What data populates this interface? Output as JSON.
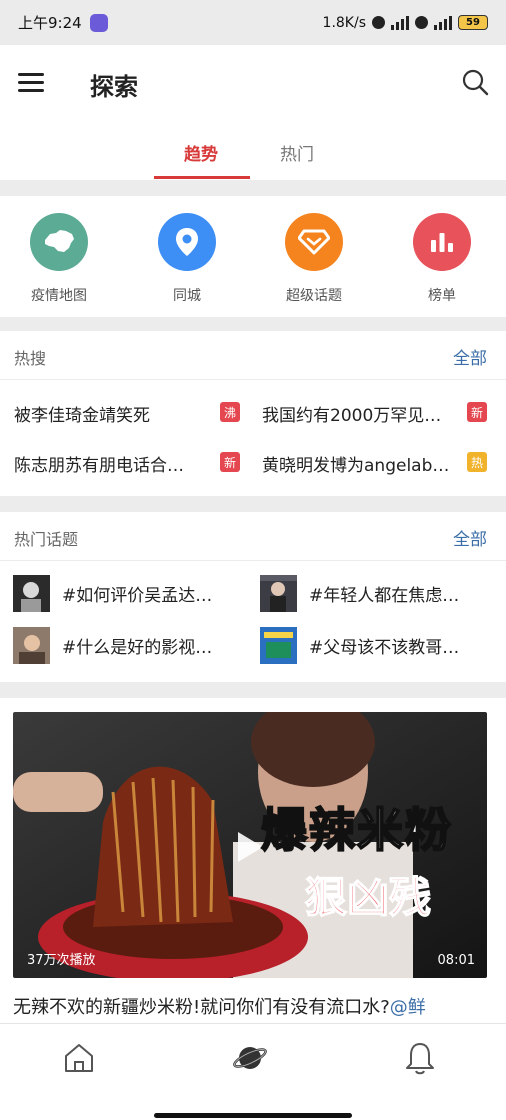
{
  "status_bar": {
    "time": "上午9:24",
    "network_speed": "1.8K/s",
    "battery": "59"
  },
  "header": {
    "title": "探索"
  },
  "tabs": [
    {
      "label": "趋势",
      "active": true
    },
    {
      "label": "热门",
      "active": false
    }
  ],
  "quick_links": [
    {
      "label": "疫情地图",
      "icon": "china-map-icon",
      "color": "#5bab95"
    },
    {
      "label": "同城",
      "icon": "location-pin-icon",
      "color": "#3d8ef5"
    },
    {
      "label": "超级话题",
      "icon": "diamond-icon",
      "color": "#f5841f"
    },
    {
      "label": "榜单",
      "icon": "bar-chart-icon",
      "color": "#e8525a"
    }
  ],
  "hot_search": {
    "title": "热搜",
    "all_label": "全部",
    "items": [
      {
        "text": "被李佳琦金靖笑死",
        "tag": "沸",
        "tag_color": "#e4474f"
      },
      {
        "text": "我国约有2000万罕见…",
        "tag": "新",
        "tag_color": "#e4474f"
      },
      {
        "text": "陈志朋苏有朋电话合…",
        "tag": "新",
        "tag_color": "#e4474f"
      },
      {
        "text": "黄晓明发博为angelab…",
        "tag": "热",
        "tag_color": "#f1b22c"
      }
    ]
  },
  "hot_topics": {
    "title": "热门话题",
    "all_label": "全部",
    "items": [
      {
        "text": "#如何评价吴孟达…"
      },
      {
        "text": "#年轻人都在焦虑…"
      },
      {
        "text": "#什么是好的影视…"
      },
      {
        "text": "#父母该不该教哥…"
      }
    ]
  },
  "video": {
    "overlay_title": "爆辣米粉",
    "overlay_subtitle": "狠凶残",
    "play_count": "37万次播放",
    "duration": "08:01",
    "title": "无辣不欢的新疆炒米粉!就问你们有没有流口水?",
    "mention": "@鲜"
  },
  "bottom_nav": [
    {
      "name": "home",
      "icon": "home-icon"
    },
    {
      "name": "explore",
      "icon": "planet-icon",
      "active": true
    },
    {
      "name": "notifications",
      "icon": "bell-icon"
    }
  ]
}
